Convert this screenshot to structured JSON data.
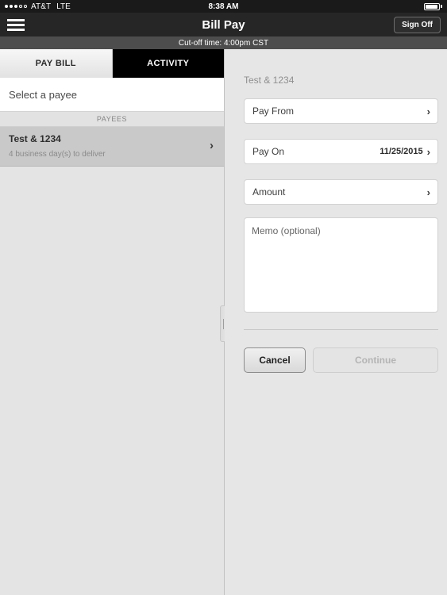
{
  "status_bar": {
    "carrier": "AT&T",
    "network": "LTE",
    "time": "8:38 AM",
    "signal_bars_filled": 3,
    "signal_bars_total": 5,
    "battery_level_percent": 92
  },
  "nav_bar": {
    "menu_icon": "hamburger-menu-icon",
    "title": "Bill Pay",
    "sign_off_label": "Sign Off"
  },
  "cutoff_banner": {
    "text": "Cut-off time: 4:00pm CST"
  },
  "left_panel": {
    "tabs": [
      {
        "label": "PAY BILL",
        "selected": true
      },
      {
        "label": "ACTIVITY",
        "selected": false
      }
    ],
    "select_payee_label": "Select a payee",
    "payees_section_header": "PAYEES",
    "payees": [
      {
        "name": "Test & 1234",
        "delivery_note": "4 business day(s) to deliver",
        "chevron": "chevron-right-icon",
        "selected": true
      }
    ]
  },
  "split_grabber": {
    "icon": "drag-handle-icon"
  },
  "right_panel": {
    "payee_title": "Test & 1234",
    "fields": [
      {
        "label": "Pay From",
        "value": "",
        "chevron": "chevron-right-icon"
      },
      {
        "label": "Pay On",
        "value": "11/25/2015",
        "chevron": "chevron-right-icon"
      },
      {
        "label": "Amount",
        "value": "",
        "chevron": "chevron-right-icon"
      }
    ],
    "memo_placeholder": "Memo (optional)",
    "buttons": {
      "cancel_label": "Cancel",
      "continue_label": "Continue",
      "continue_disabled": true
    }
  },
  "colors": {
    "nav_bar_bg": "#262626",
    "status_bar_bg": "#1a1a1a",
    "cutoff_bg": "#4d4d4d",
    "panel_bg": "#e6e6e6",
    "selected_row_bg": "#c9c9c9",
    "active_tab_bg": "#f7f7f7",
    "inactive_tab_bg": "#000000"
  }
}
